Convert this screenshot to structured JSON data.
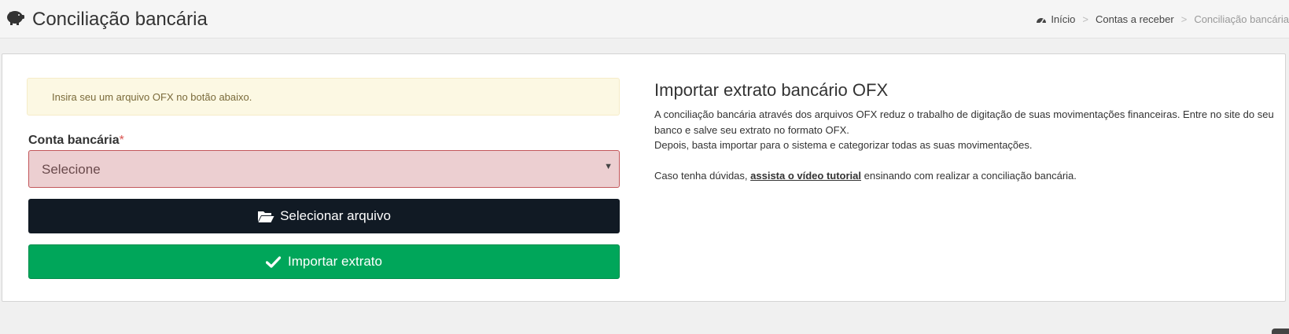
{
  "header": {
    "title": "Conciliação bancária",
    "icon": "piggy-bank-icon",
    "breadcrumb": [
      "Início",
      "Contas a receber",
      "Conciliação bancária"
    ],
    "breadcrumb_separator": ">"
  },
  "form": {
    "alert_text": "Insira seu um arquivo OFX no botão abaixo.",
    "account_label": "Conta bancária",
    "required_marker": "*",
    "account_select_value": "Selecione",
    "select_file_label": "Selecionar arquivo",
    "import_label": "Importar extrato"
  },
  "info": {
    "title": "Importar extrato bancário OFX",
    "line1": "A conciliação bancária através dos arquivos OFX reduz o trabalho de digitação de suas movimentações financeiras. Entre no site do seu banco e salve seu extrato no formato OFX.",
    "line2": "Depois, basta importar para o sistema e categorizar todas as suas movimentações.",
    "help_prefix": "Caso tenha dúvidas, ",
    "help_link": "assista o vídeo tutorial",
    "help_suffix": " ensinando com realizar a conciliação bancária."
  },
  "colors": {
    "select_file_button": "#111a24",
    "import_button": "#00a65a",
    "alert_background": "#fcf8e3",
    "select_error_background": "#eccfd1",
    "select_error_border": "#c2575b"
  }
}
